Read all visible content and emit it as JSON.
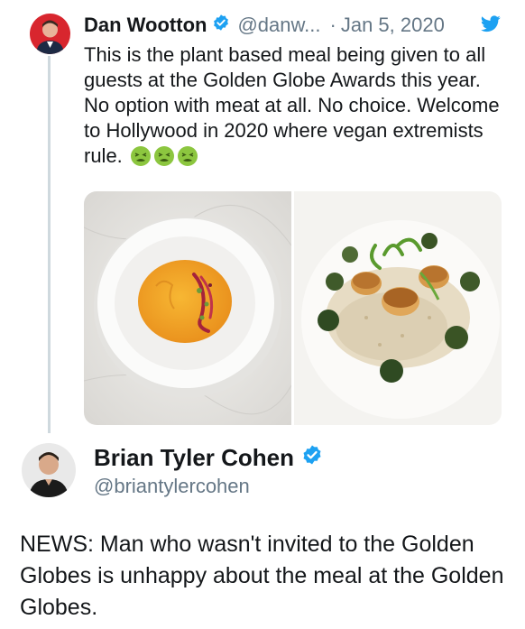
{
  "tweet1": {
    "author_name": "Dan Wootton",
    "handle": "@danw...",
    "separator": "·",
    "date": "Jan 5, 2020",
    "text": "This is the plant based meal being given to all guests at the Golden Globe Awards this year. No option with meat at all. No choice. Welcome to Hollywood in 2020 where vegan extremists rule.",
    "emojis": [
      "nauseated-face",
      "nauseated-face",
      "nauseated-face"
    ],
    "media": [
      "soup-bowl-photo",
      "scallops-risotto-photo"
    ]
  },
  "tweet2": {
    "author_name": "Brian Tyler Cohen",
    "handle": "@briantylercohen",
    "text": "NEWS: Man who wasn't invited to the Golden Globes is unhappy about the meal at the Golden Globes."
  },
  "colors": {
    "verified_blue": "#1da1f2",
    "muted_text": "#657786",
    "thread_line": "#cfd9de"
  },
  "icons": [
    "verified-icon",
    "twitter-bird-icon"
  ]
}
